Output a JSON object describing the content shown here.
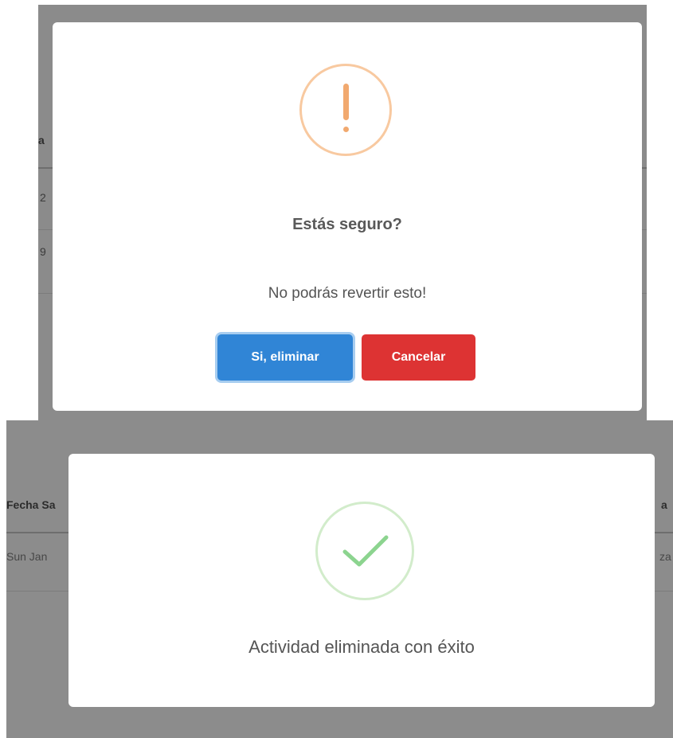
{
  "warning_dialog": {
    "icon": "exclamation-icon",
    "title": "Estás seguro?",
    "text": "No podrás revertir esto!",
    "confirm_label": "Si, eliminar",
    "cancel_label": "Cancelar",
    "colors": {
      "icon": "#f1a96f",
      "confirm": "#3085d6",
      "cancel": "#dd3333"
    }
  },
  "background_table_top": {
    "header_fragment": "Fecha Sa",
    "cells": [
      "2",
      "9"
    ]
  },
  "success_dialog": {
    "icon": "checkmark-icon",
    "text": "Actividad eliminada con éxito",
    "colors": {
      "icon": "#8cd48f"
    }
  },
  "background_table_bottom": {
    "header_left": "Fecha Sa",
    "header_right": "a",
    "cell_left": "Sun Jan",
    "cell_right": "za"
  }
}
